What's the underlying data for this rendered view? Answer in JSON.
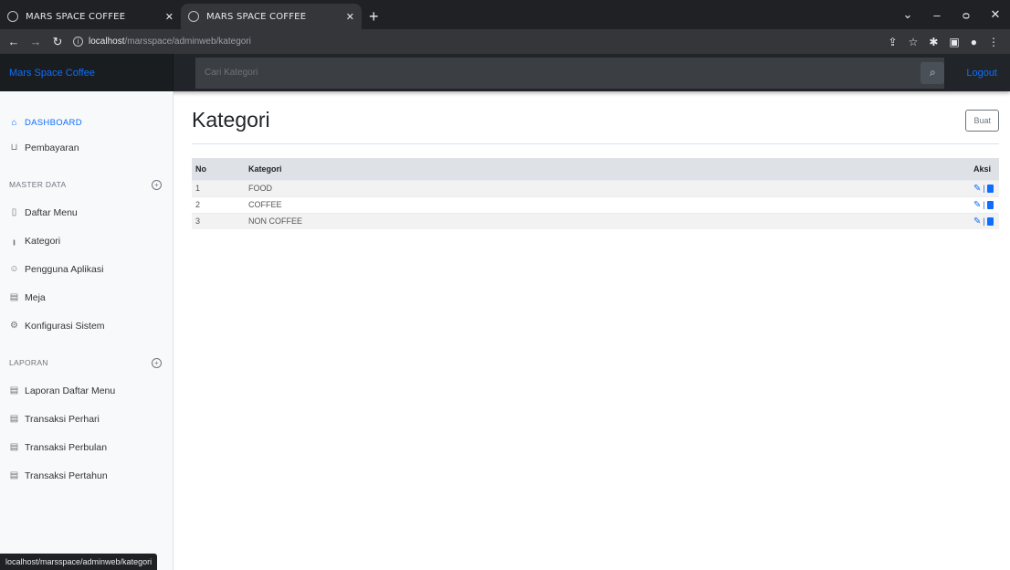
{
  "browser": {
    "tabs": [
      {
        "title": "MARS SPACE COFFEE",
        "active": false
      },
      {
        "title": "MARS SPACE COFFEE",
        "active": true
      }
    ],
    "new_tab": "+",
    "window_controls": [
      "⌄",
      "–",
      "ᴑ",
      "✕"
    ],
    "url_host": "localhost",
    "url_path": "/marsspace/adminweb/kategori",
    "status_url": "localhost/marsspace/adminweb/kategori"
  },
  "navbar": {
    "brand": "Mars Space Coffee",
    "search_placeholder": "Cari Kategori",
    "search_icon": "search-icon",
    "logout": "Logout"
  },
  "sidebar": {
    "items_top": [
      {
        "label": "DASHBOARD",
        "icon": "home-icon"
      },
      {
        "label": "Pembayaran",
        "icon": "cart-icon"
      }
    ],
    "master_heading": "MASTER DATA",
    "master_items": [
      {
        "label": "Daftar Menu",
        "icon": "file-icon"
      },
      {
        "label": "Kategori",
        "icon": "bar-chart-icon"
      },
      {
        "label": "Pengguna Aplikasi",
        "icon": "users-icon"
      },
      {
        "label": "Meja",
        "icon": "layers-icon"
      },
      {
        "label": "Konfigurasi Sistem",
        "icon": "settings-icon"
      }
    ],
    "laporan_heading": "LAPORAN",
    "laporan_items": [
      {
        "label": "Laporan Daftar Menu",
        "icon": "file-text-icon"
      },
      {
        "label": "Transaksi Perhari",
        "icon": "file-text-icon"
      },
      {
        "label": "Transaksi Perbulan",
        "icon": "file-text-icon"
      },
      {
        "label": "Transaksi Pertahun",
        "icon": "file-text-icon"
      }
    ]
  },
  "main": {
    "title": "Kategori",
    "create_button": "Buat",
    "table": {
      "headers": [
        "No",
        "Kategori",
        "Aksi"
      ],
      "rows": [
        {
          "no": "1",
          "kategori": "FOOD"
        },
        {
          "no": "2",
          "kategori": "COFFEE"
        },
        {
          "no": "3",
          "kategori": "NON COFFEE"
        }
      ],
      "action_separator": "|"
    }
  },
  "colors": {
    "accent": "#0d6efd",
    "navbar_bg": "#212529",
    "sidebar_bg": "#f8f9fa",
    "browser_bg": "#202124"
  }
}
